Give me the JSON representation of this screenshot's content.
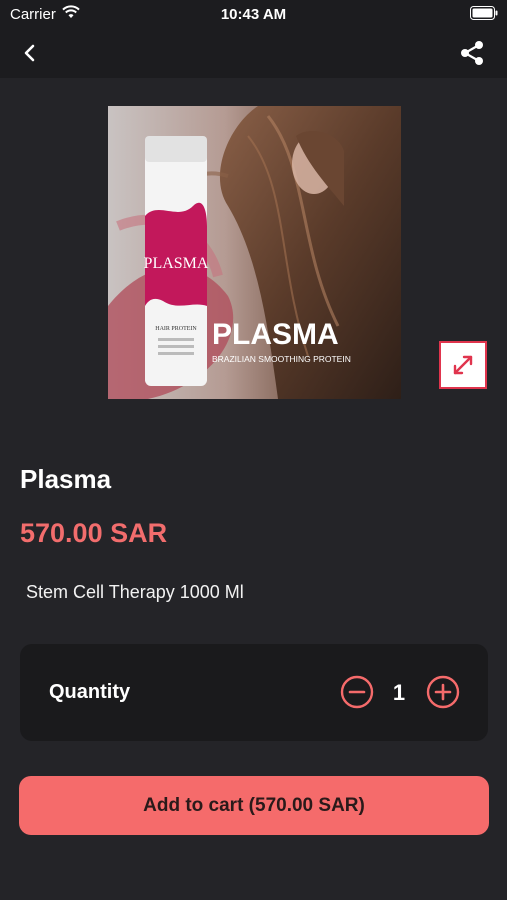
{
  "status_bar": {
    "carrier": "Carrier",
    "time": "10:43 AM"
  },
  "nav": {
    "back_icon": "chevron-left-icon",
    "share_icon": "share-icon"
  },
  "product": {
    "image_text": {
      "title": "PLASMA",
      "subtitle": "BRAZILIAN SMOOTHING PROTEIN",
      "bottle_label": "PLASMA",
      "bottle_caption": "HAIR PROTEIN"
    },
    "name": "Plasma",
    "price": "570.00 SAR",
    "description": "Stem Cell Therapy 1000 Ml"
  },
  "quantity": {
    "label": "Quantity",
    "value": "1"
  },
  "cart": {
    "button_label": "Add to cart (570.00 SAR)"
  },
  "colors": {
    "accent": "#f56b6b",
    "background": "#242428",
    "card": "#1a1a1c",
    "brand_magenta": "#c2185b"
  }
}
